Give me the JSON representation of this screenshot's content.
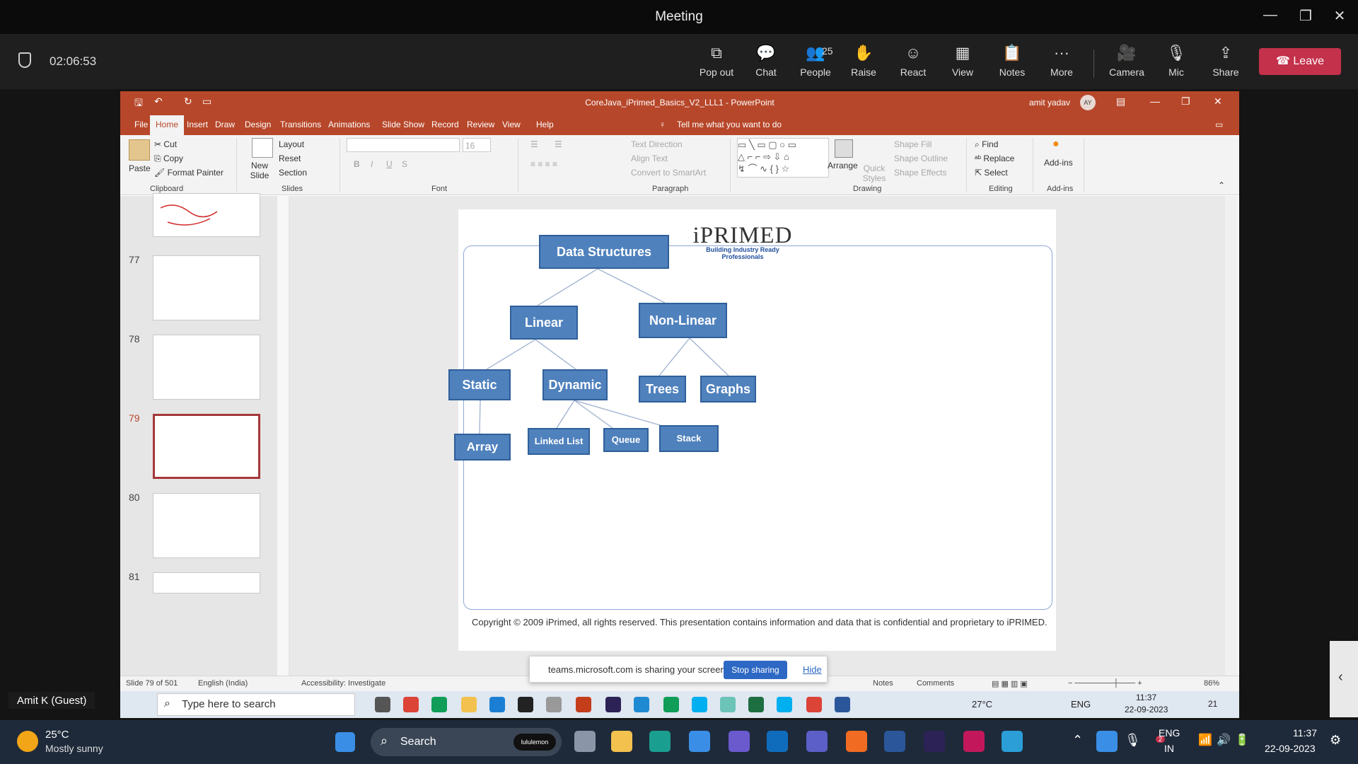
{
  "teams": {
    "window_title": "Meeting",
    "timer": "02:06:53",
    "toolbar": [
      {
        "name": "pop-out-button",
        "label": "Pop out",
        "icon": "pop-out-icon",
        "glyph": "⧉"
      },
      {
        "name": "chat-button",
        "label": "Chat",
        "icon": "chat-icon",
        "glyph": "💬"
      },
      {
        "name": "people-button",
        "label": "People",
        "icon": "people-icon",
        "glyph": "👥",
        "count": "25"
      },
      {
        "name": "raise-button",
        "label": "Raise",
        "icon": "hand-icon",
        "glyph": "✋"
      },
      {
        "name": "react-button",
        "label": "React",
        "icon": "smile-icon",
        "glyph": "☺"
      },
      {
        "name": "view-button",
        "label": "View",
        "icon": "view-grid-icon",
        "glyph": "▦"
      },
      {
        "name": "notes-button",
        "label": "Notes",
        "icon": "notes-icon",
        "glyph": "📋"
      },
      {
        "name": "more-button",
        "label": "More",
        "icon": "more-dots-icon",
        "glyph": "···"
      },
      {
        "name": "camera-button",
        "label": "Camera",
        "icon": "camera-icon",
        "glyph": "🎥"
      },
      {
        "name": "mic-button",
        "label": "Mic",
        "icon": "mic-muted-icon",
        "glyph": "🎙"
      },
      {
        "name": "share-button",
        "label": "Share",
        "icon": "share-icon",
        "glyph": "⇪"
      }
    ],
    "leave_label": "Leave",
    "participant_name": "Amit K (Guest)"
  },
  "ppt": {
    "title": "CoreJava_iPrimed_Basics_V2_LLL1 - PowerPoint",
    "user_name": "amit yadav",
    "user_initials": "AY",
    "tabs": [
      "File",
      "Home",
      "Insert",
      "Draw",
      "Design",
      "Transitions",
      "Animations",
      "Slide Show",
      "Record",
      "Review",
      "View",
      "Help"
    ],
    "tell_me": "Tell me what you want to do",
    "clipboard": {
      "paste": "Paste",
      "cut": "Cut",
      "copy": "Copy",
      "format_painter": "Format Painter",
      "label": "Clipboard"
    },
    "slides_group": {
      "new_slide": "New Slide",
      "layout": "Layout",
      "reset": "Reset",
      "section": "Section",
      "label": "Slides"
    },
    "font_group": {
      "size": "16",
      "label": "Font"
    },
    "paragraph_group": {
      "text_direction": "Text Direction",
      "align_text": "Align Text",
      "convert": "Convert to SmartArt",
      "label": "Paragraph"
    },
    "drawing_group": {
      "arrange": "Arrange",
      "quick_styles": "Quick Styles",
      "shape_fill": "Shape Fill",
      "shape_outline": "Shape Outline",
      "shape_effects": "Shape Effects",
      "label": "Drawing"
    },
    "editing_group": {
      "find": "Find",
      "replace": "Replace",
      "select": "Select",
      "label": "Editing"
    },
    "addins_group": {
      "addins": "Add-ins",
      "label": "Add-ins"
    },
    "thumbnails": [
      {
        "num": "77"
      },
      {
        "num": "78"
      },
      {
        "num": "79",
        "selected": true
      },
      {
        "num": "80"
      },
      {
        "num": "81"
      }
    ],
    "status": {
      "slide": "Slide 79 of 501",
      "language": "English (India)",
      "accessibility": "Accessibility: Investigate",
      "notes": "Notes",
      "comments": "Comments",
      "zoom": "86%"
    }
  },
  "slide": {
    "logo_name": "iPRIMED",
    "logo_tagline": "Building Industry Ready Professionals",
    "nodes": {
      "root": "Data Structures",
      "linear": "Linear",
      "nonlinear": "Non-Linear",
      "static": "Static",
      "dynamic": "Dynamic",
      "trees": "Trees",
      "graphs": "Graphs",
      "array": "Array",
      "linkedlist": "Linked List",
      "queue": "Queue",
      "stack": "Stack"
    },
    "copyright": "Copyright © 2009 iPrimed, all rights reserved. This presentation contains information  and data  that is confidential and proprietary to iPRIMED."
  },
  "share_banner": {
    "text": "teams.microsoft.com is sharing your screen.",
    "stop": "Stop sharing",
    "hide": "Hide"
  },
  "inner_taskbar": {
    "search": "Type here to search",
    "weather": "27°C",
    "lang": "ENG",
    "time": "11:37",
    "date": "22-09-2023",
    "notif": "21"
  },
  "taskbar": {
    "weather_temp": "25°C",
    "weather_desc": "Mostly sunny",
    "search": "Search",
    "pill": "lululemon",
    "lang1": "ENG",
    "lang2": "IN",
    "time": "11:37",
    "date": "22-09-2023",
    "teams_badge": "2"
  },
  "colors": {
    "teams_leave": "#c4314b",
    "ppt_accent": "#b7472a",
    "node_fill": "#4f81bd",
    "node_border": "#2f5f9a",
    "stop_button": "#2d68c4"
  }
}
